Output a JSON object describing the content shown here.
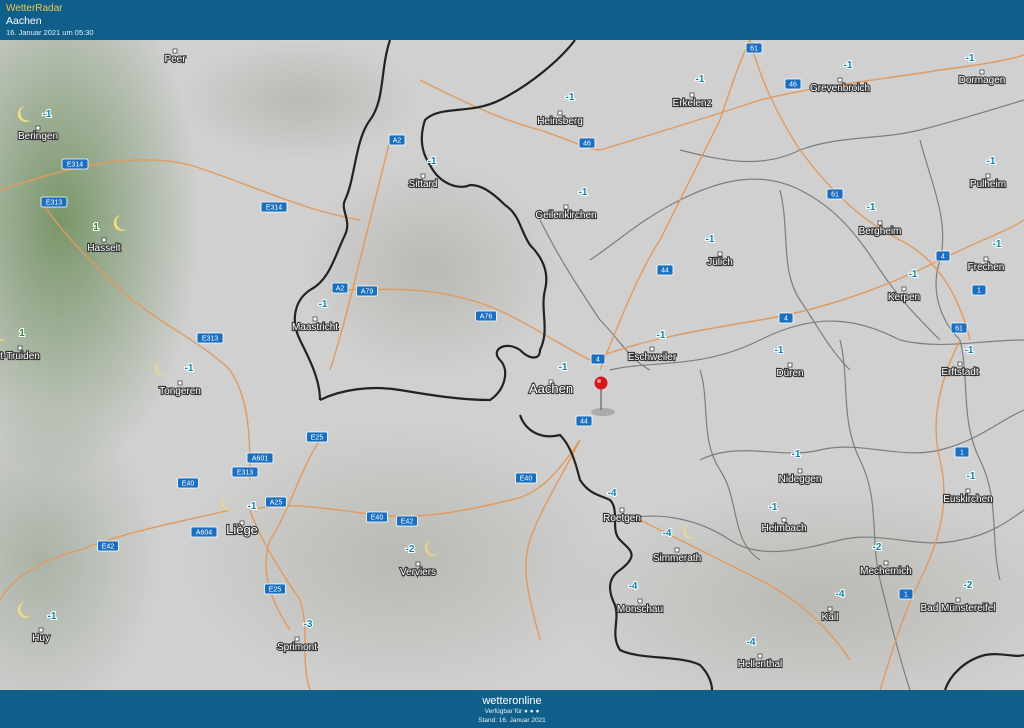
{
  "header": {
    "app_name": "WetterRadar",
    "location": "Aachen",
    "timestamp": "16. Januar 2021 um 05:30"
  },
  "footer": {
    "brand": "wetteronline",
    "availability": "Verfügbar für ● ● ●",
    "stand": "Stand: 16. Januar 2021"
  },
  "colors": {
    "header_bg": "#0f5f8a",
    "road_shield": "#1b6fc0",
    "temperature": "#0c86a8",
    "pin": "#d7161b"
  },
  "map": {
    "cities": [
      {
        "name": "Peer",
        "temp": ""
      },
      {
        "name": "Beringen",
        "temp": "-1"
      },
      {
        "name": "Hasselt",
        "temp": "1"
      },
      {
        "name": "t-Truiden",
        "temp": "1"
      },
      {
        "name": "Tongeren",
        "temp": "-1"
      },
      {
        "name": "Maastricht",
        "temp": "-1"
      },
      {
        "name": "Sittard",
        "temp": "-1"
      },
      {
        "name": "Heinsberg",
        "temp": "-1"
      },
      {
        "name": "Geilenkirchen",
        "temp": "-1"
      },
      {
        "name": "Erkelenz",
        "temp": "-1"
      },
      {
        "name": "Grevenbroich",
        "temp": "-1"
      },
      {
        "name": "Dormagen",
        "temp": "-1"
      },
      {
        "name": "Pulheim",
        "temp": "-1"
      },
      {
        "name": "Bergheim",
        "temp": "-1"
      },
      {
        "name": "Jülich",
        "temp": "-1"
      },
      {
        "name": "Frechen",
        "temp": "-1"
      },
      {
        "name": "Kerpen",
        "temp": "-1"
      },
      {
        "name": "Eschweiler",
        "temp": "-1"
      },
      {
        "name": "Aachen",
        "temp": "-1"
      },
      {
        "name": "Düren",
        "temp": "-1"
      },
      {
        "name": "Erftstadt",
        "temp": "-1"
      },
      {
        "name": "Liège",
        "temp": "-1"
      },
      {
        "name": "Verviers",
        "temp": "-2"
      },
      {
        "name": "Roetgen",
        "temp": "-4"
      },
      {
        "name": "Simmerath",
        "temp": "-4"
      },
      {
        "name": "Nideggen",
        "temp": "-1"
      },
      {
        "name": "Heimbach",
        "temp": "-1"
      },
      {
        "name": "Euskirchen",
        "temp": "-1"
      },
      {
        "name": "Mechernich",
        "temp": "-2"
      },
      {
        "name": "Monschau",
        "temp": "-4"
      },
      {
        "name": "Kall",
        "temp": "-4"
      },
      {
        "name": "Bad Münstereifel",
        "temp": "-2"
      },
      {
        "name": "Hellenthal",
        "temp": "-4"
      },
      {
        "name": "Huy",
        "temp": "-1"
      },
      {
        "name": "Sprimont",
        "temp": "-3"
      }
    ],
    "roads": [
      "61",
      "46",
      "A2",
      "46",
      "E314",
      "E313",
      "E314",
      "61",
      "A2",
      "A79",
      "44",
      "4",
      "4",
      "1",
      "A76",
      "61",
      "E313",
      "4",
      "44",
      "E25",
      "A601",
      "E313",
      "E40",
      "E40",
      "1",
      "A25",
      "A604",
      "E40",
      "E42",
      "E42",
      "E25",
      "1"
    ]
  }
}
